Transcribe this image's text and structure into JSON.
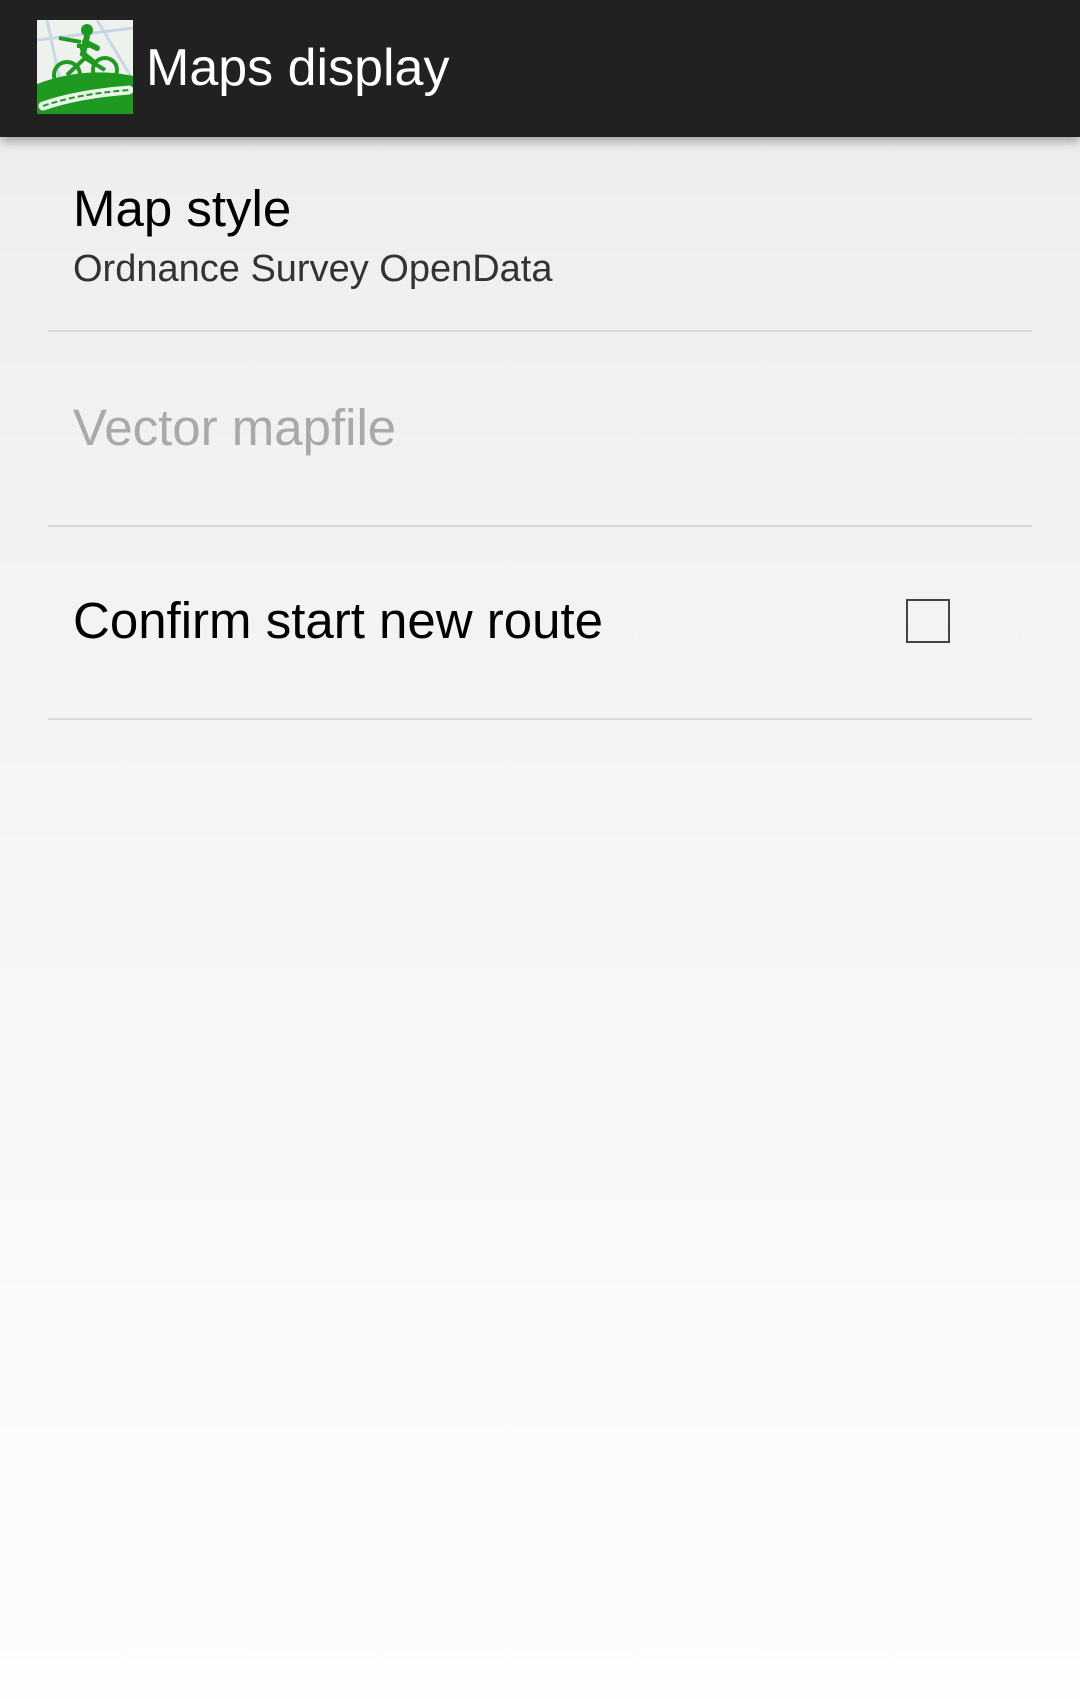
{
  "app": {
    "title": "Maps display",
    "logo_icon": "cyclestreets-logo-icon"
  },
  "preferences": [
    {
      "title": "Map style",
      "summary": "Ordnance Survey OpenData",
      "enabled": true
    },
    {
      "title": "Vector mapfile",
      "summary": "",
      "enabled": false
    },
    {
      "title": "Confirm start new route",
      "checked": false,
      "enabled": true
    }
  ],
  "colors": {
    "action_bar": "#212121",
    "logo_green": "#1f9a21",
    "disabled_text": "#a9a9a9"
  }
}
